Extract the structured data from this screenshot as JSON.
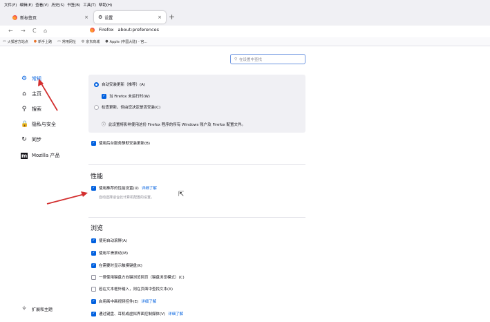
{
  "menu": [
    "文件(F)",
    "编辑(E)",
    "查看(V)",
    "历史(S)",
    "书签(B)",
    "工具(T)",
    "帮助(H)"
  ],
  "tabs": {
    "inactive": {
      "label": "新标签页",
      "close": "×"
    },
    "active": {
      "label": "设置",
      "close": "×"
    },
    "new_tab": "+"
  },
  "nav": {
    "back": "←",
    "forward": "→",
    "reload": "C",
    "home": "⌂",
    "identity": "Firefox",
    "url": "about:preferences"
  },
  "bookmarks": [
    "火狐官方站点",
    "新手上路",
    "常用网址",
    "京东商城",
    "Apple (中国大陆) - 官..."
  ],
  "search": {
    "placeholder": "在设置中查找"
  },
  "sidebar": {
    "items": [
      {
        "label": "常规",
        "icon": "gear-icon",
        "glyph": "⚙"
      },
      {
        "label": "主页",
        "icon": "home-icon",
        "glyph": "⌂"
      },
      {
        "label": "搜索",
        "icon": "search-icon",
        "glyph": "⚲"
      },
      {
        "label": "隐私与安全",
        "icon": "lock-icon",
        "glyph": "🔒"
      },
      {
        "label": "同步",
        "icon": "sync-icon",
        "glyph": "↻"
      },
      {
        "label": "Mozilla 产品",
        "icon": "mozilla-icon",
        "glyph": "m"
      }
    ],
    "footer": {
      "label": "扩展和主题",
      "glyph": "✧"
    }
  },
  "updates": {
    "auto_install": "自动安装更新（推荐）(A)",
    "when_not_running": "当 Firefox 未运行时(W)",
    "check_only": "检查更新，但由您决定是否安装(C)",
    "info": "此设置将影响使用这份 Firefox 程序的所有 Windows 账户及 Firefox 配置文件。",
    "background_service": "使用后台服务静默安装更新(B)"
  },
  "performance": {
    "heading": "性能",
    "recommended": "使用推荐的性能设置(U)",
    "learn_more": "详细了解",
    "description": "自动选择适合此计算机配置的设置。"
  },
  "browsing": {
    "heading": "浏览",
    "items": [
      {
        "label": "使用自动滚屏(A)",
        "checked": true
      },
      {
        "label": "使用平滑滚动(M)",
        "checked": true
      },
      {
        "label": "在需要时显示触摸键盘(K)",
        "checked": true
      },
      {
        "label": "一律使用键盘方向键浏览网页（键盘浏览模式）(C)",
        "checked": false
      },
      {
        "label": "若在文本框外输入，则在页面中查找文本(X)",
        "checked": false
      },
      {
        "label": "启用画中画视频控件(E)",
        "checked": true,
        "link": "详细了解"
      },
      {
        "label": "通过键盘、耳机或虚拟界面控制媒体(V)",
        "checked": true,
        "link": "详细了解"
      }
    ]
  },
  "colors": {
    "accent": "#0060df",
    "arrow": "#d32f2f"
  }
}
